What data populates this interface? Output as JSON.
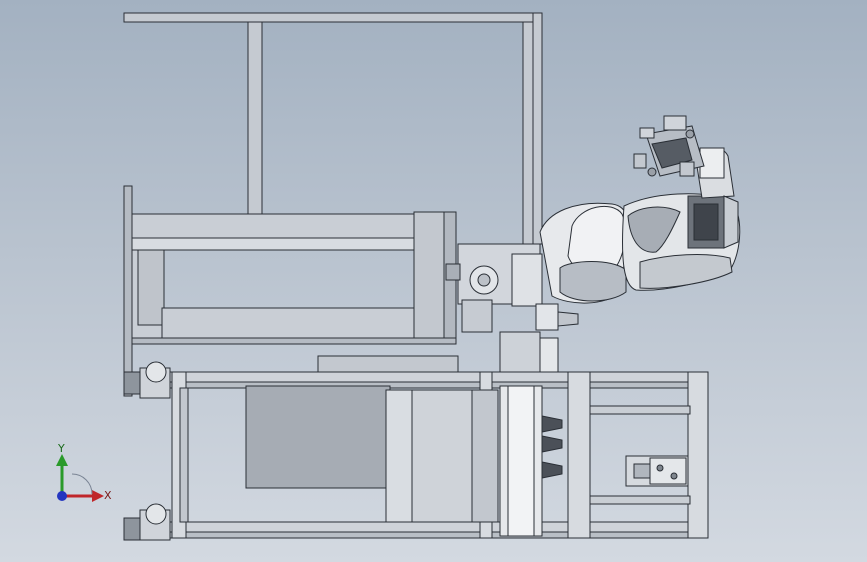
{
  "viewport": {
    "kind": "cad-3d-viewport",
    "background_top": "#a3b1c1",
    "background_bottom": "#d3d9e1"
  },
  "model": {
    "line_color": "#2a2f36",
    "fill_light": "#dde1e6",
    "fill_mid": "#b8bec6",
    "fill_dark": "#8d949c"
  },
  "triad": {
    "x_label": "X",
    "y_label": "Y",
    "x_color": "#c0262a",
    "y_color": "#2a9a2a",
    "z_color": "#2436c0"
  }
}
